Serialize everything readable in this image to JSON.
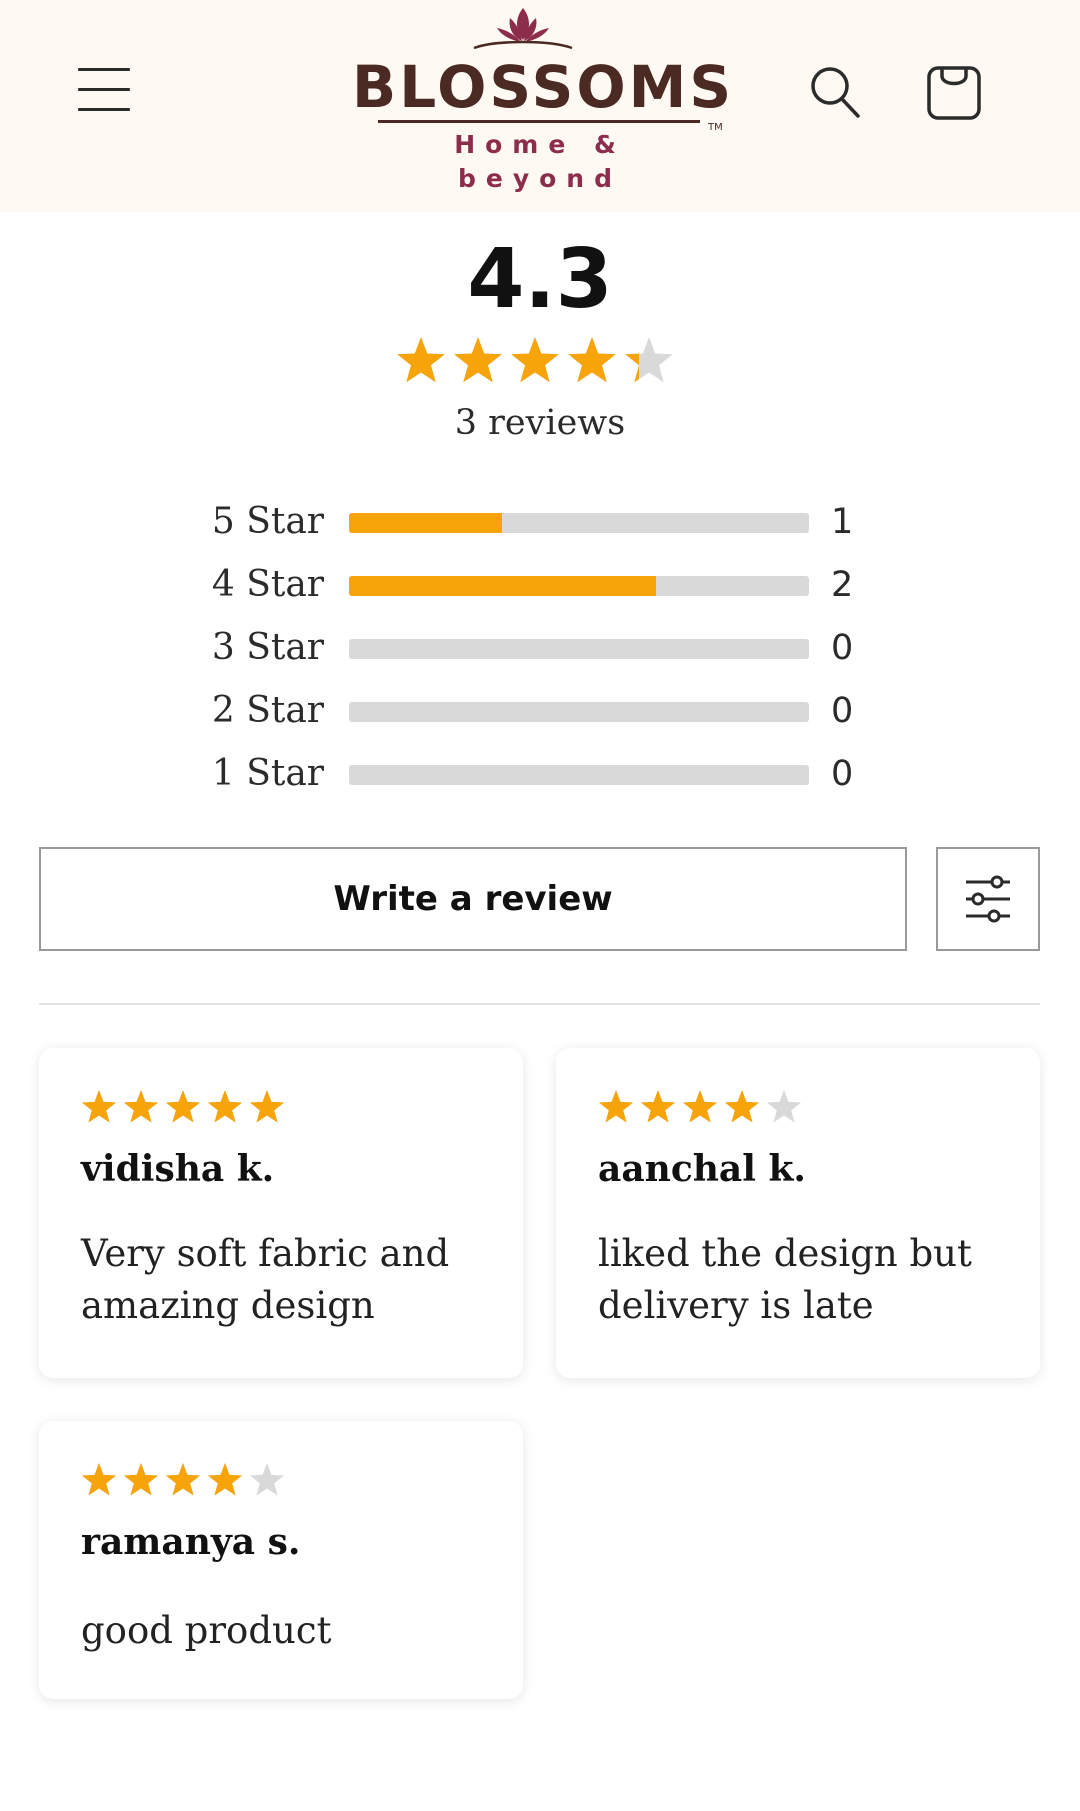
{
  "brand": {
    "name": "BLOSSOMS",
    "tagline": "Home & beyond",
    "trademark": "TM"
  },
  "colors": {
    "header_bg": "#fefaf3",
    "star_filled": "#f7a30a",
    "star_empty": "#d9d9d9",
    "brand_brown": "#4a2a22",
    "brand_magenta": "#8c2d4b"
  },
  "icons": {
    "menu": "hamburger-icon",
    "search": "search-icon",
    "cart": "bag-icon",
    "filter": "sliders-icon",
    "logo_mark": "lotus-icon"
  },
  "summary": {
    "average": "4.3",
    "rating_value": 4.3,
    "review_count_label": "3 reviews"
  },
  "distribution": [
    {
      "label": "5 Star",
      "count": "1",
      "fraction": 0.333
    },
    {
      "label": "4 Star",
      "count": "2",
      "fraction": 0.667
    },
    {
      "label": "3 Star",
      "count": "0",
      "fraction": 0
    },
    {
      "label": "2 Star",
      "count": "0",
      "fraction": 0
    },
    {
      "label": "1 Star",
      "count": "0",
      "fraction": 0
    }
  ],
  "actions": {
    "write_review": "Write a review"
  },
  "reviews": [
    {
      "rating": 5,
      "name": "vidisha k.",
      "text": "Very soft fabric and amazing design"
    },
    {
      "rating": 4,
      "name": "aanchal k.",
      "text": "liked the design but delivery is late"
    },
    {
      "rating": 4,
      "name": "ramanya s.",
      "text": "good product"
    }
  ]
}
